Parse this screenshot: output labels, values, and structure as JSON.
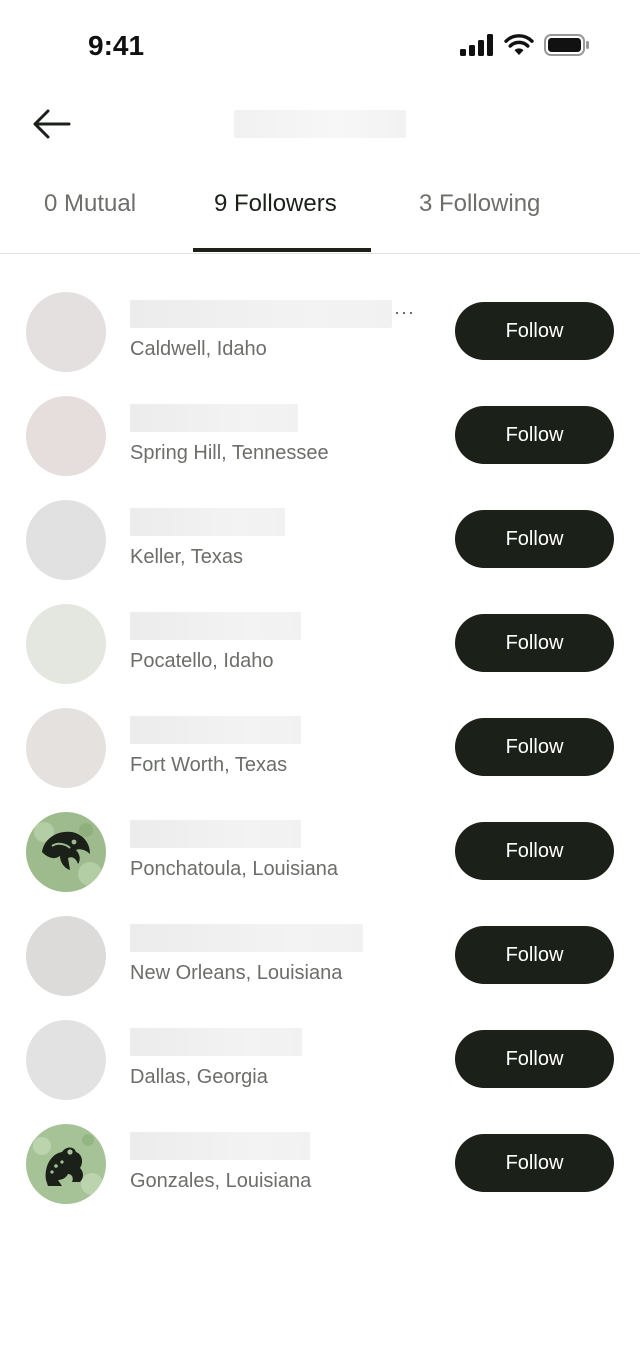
{
  "status_bar": {
    "time": "9:41",
    "icons": [
      "cellular-signal-icon",
      "wifi-icon",
      "battery-icon"
    ]
  },
  "header": {
    "back_icon": "arrow-left-icon"
  },
  "tabs": [
    {
      "label": "0 Mutual",
      "active": false
    },
    {
      "label": "9 Followers",
      "active": true
    },
    {
      "label": "3 Following",
      "active": false
    }
  ],
  "followers": [
    {
      "location": "Caldwell, Idaho",
      "button": "Follow",
      "avatar": "blank-avatar",
      "name_truncated": true,
      "avatar_color": "#e3e0df"
    },
    {
      "location": "Spring Hill, Tennessee",
      "button": "Follow",
      "avatar": "blank-avatar",
      "avatar_color": "#e6dddd"
    },
    {
      "location": "Keller, Texas",
      "button": "Follow",
      "avatar": "blank-avatar",
      "avatar_color": "#e1e1e1"
    },
    {
      "location": "Pocatello, Idaho",
      "button": "Follow",
      "avatar": "blank-avatar",
      "avatar_color": "#e4e7e0"
    },
    {
      "location": "Fort Worth, Texas",
      "button": "Follow",
      "avatar": "blank-avatar",
      "avatar_color": "#e4e1df"
    },
    {
      "location": "Ponchatoula, Louisiana",
      "button": "Follow",
      "avatar": "eagle-logo-avatar",
      "avatar_color": "#9dbb8c"
    },
    {
      "location": "New Orleans, Louisiana",
      "button": "Follow",
      "avatar": "blank-avatar",
      "avatar_color": "#dcdbda"
    },
    {
      "location": "Dallas, Georgia",
      "button": "Follow",
      "avatar": "blank-avatar",
      "avatar_color": "#e2e2e2"
    },
    {
      "location": "Gonzales, Louisiana",
      "button": "Follow",
      "avatar": "frog-logo-avatar",
      "avatar_color": "#a5c397"
    }
  ],
  "colors": {
    "button_bg": "#1b2019",
    "button_text": "#ffffff",
    "active_tab": "#1b2019",
    "inactive_tab": "#6d6f6b"
  }
}
